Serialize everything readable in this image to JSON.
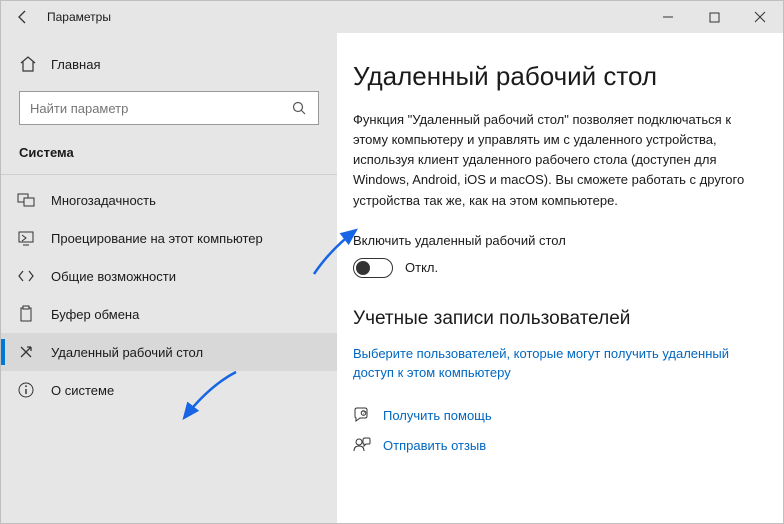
{
  "window": {
    "title": "Параметры"
  },
  "sidebar": {
    "home": "Главная",
    "search_placeholder": "Найти параметр",
    "category": "Система",
    "items": [
      {
        "label": "Многозадачность",
        "selected": false,
        "icon": "multitask"
      },
      {
        "label": "Проецирование на этот компьютер",
        "selected": false,
        "icon": "project"
      },
      {
        "label": "Общие возможности",
        "selected": false,
        "icon": "shared"
      },
      {
        "label": "Буфер обмена",
        "selected": false,
        "icon": "clipboard"
      },
      {
        "label": "Удаленный рабочий стол",
        "selected": true,
        "icon": "remote"
      },
      {
        "label": "О системе",
        "selected": false,
        "icon": "about"
      }
    ]
  },
  "main": {
    "heading": "Удаленный рабочий стол",
    "description": "Функция \"Удаленный рабочий стол\" позволяет подключаться к этому компьютеру и управлять им с удаленного устройства, используя клиент удаленного рабочего стола (доступен для Windows, Android, iOS и macOS). Вы сможете работать с другого устройства так же, как на этом компьютере.",
    "toggle_label": "Включить удаленный рабочий стол",
    "toggle_state": "Откл.",
    "users_heading": "Учетные записи пользователей",
    "users_link": "Выберите пользователей, которые могут получить удаленный доступ к этом компьютеру",
    "help": "Получить помощь",
    "feedback": "Отправить отзыв"
  }
}
